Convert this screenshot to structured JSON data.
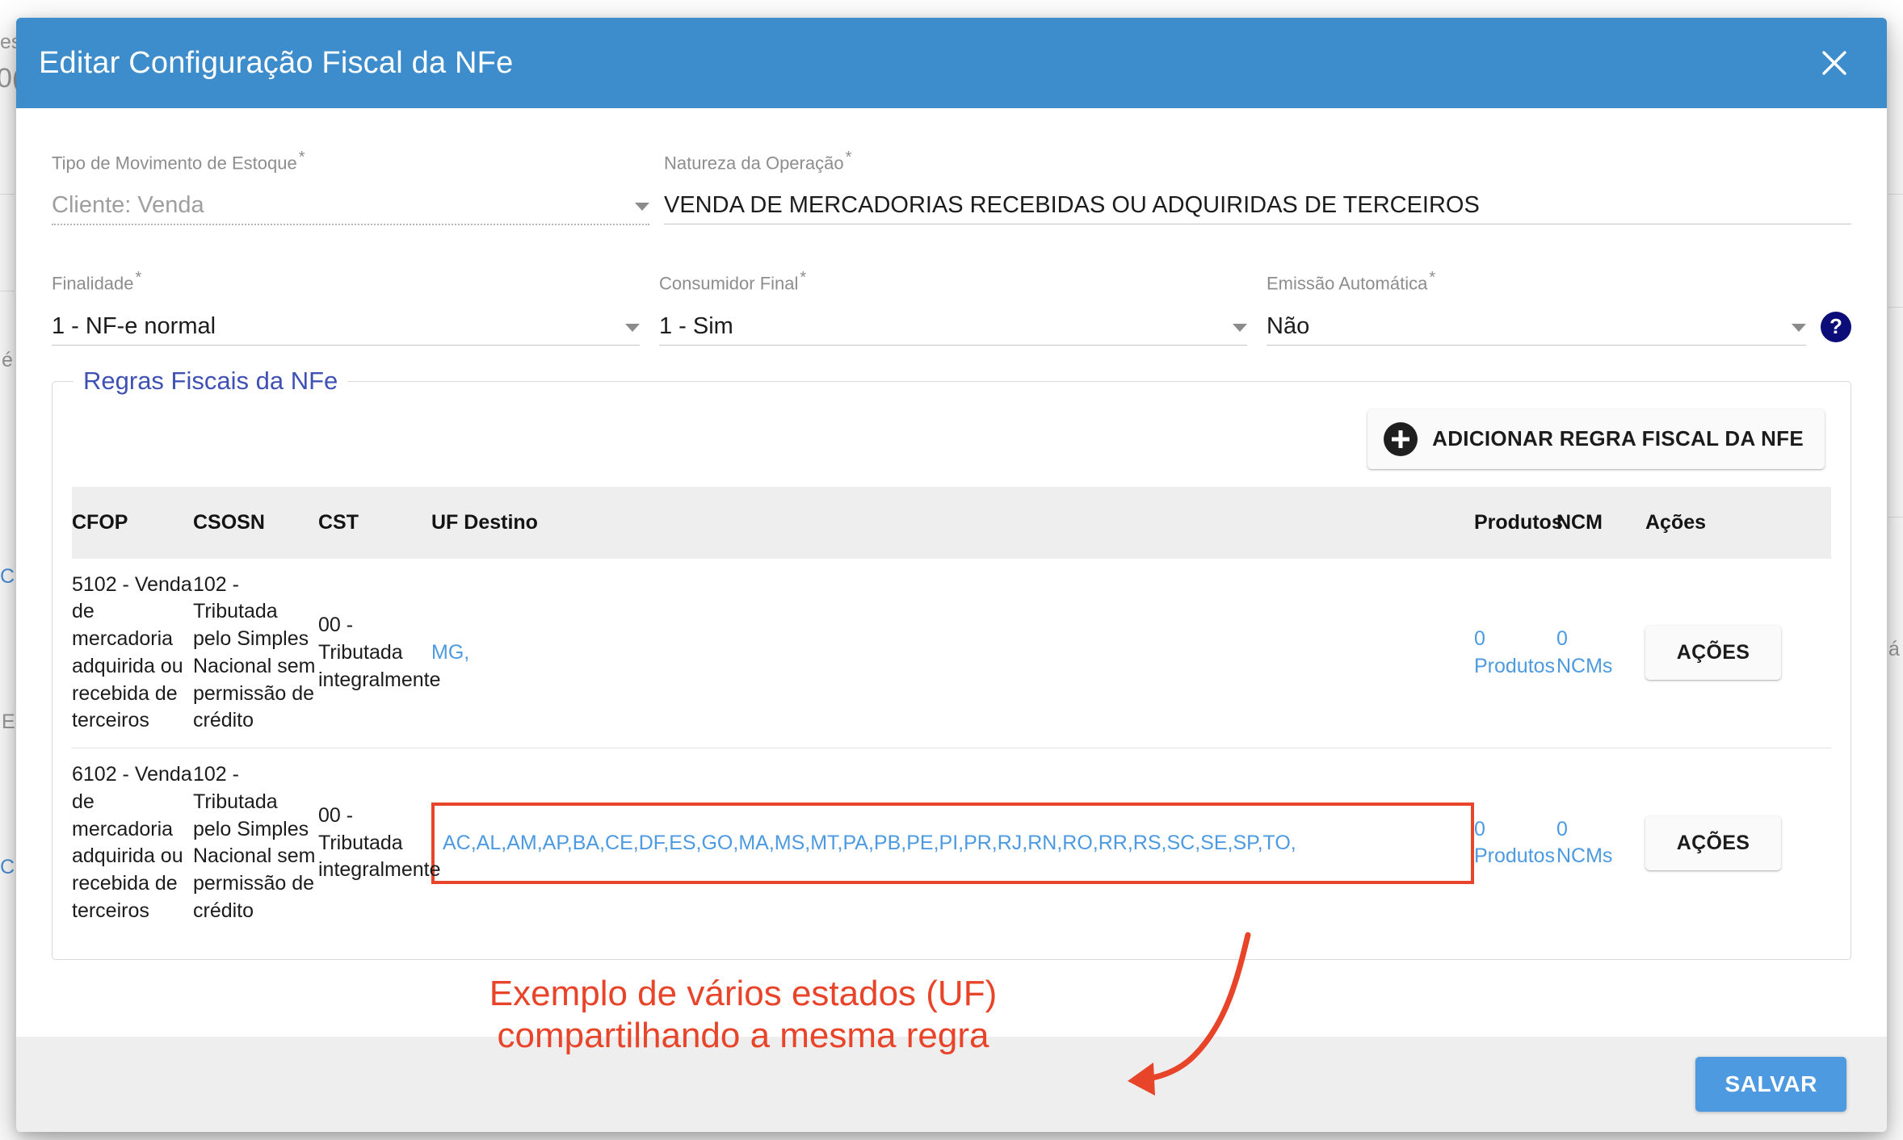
{
  "modal": {
    "title": "Editar Configuração Fiscal da NFe",
    "close_icon": "close-icon"
  },
  "form": {
    "tipo_movimento": {
      "label": "Tipo de Movimento de Estoque",
      "required_mark": "*",
      "value": "Cliente: Venda"
    },
    "natureza_operacao": {
      "label": "Natureza da Operação",
      "required_mark": "*",
      "value": "VENDA DE MERCADORIAS RECEBIDAS OU ADQUIRIDAS DE TERCEIROS"
    },
    "finalidade": {
      "label": "Finalidade",
      "required_mark": "*",
      "value": "1 - NF-e normal"
    },
    "consumidor_final": {
      "label": "Consumidor Final",
      "required_mark": "*",
      "value": "1 - Sim"
    },
    "emissao_automatica": {
      "label": "Emissão Automática",
      "required_mark": "*",
      "value": "Não"
    },
    "help_tooltip_icon": "question-mark-icon"
  },
  "rules_section": {
    "legend": "Regras Fiscais da NFe",
    "add_button_label": "ADICIONAR REGRA FISCAL DA NFE",
    "columns": {
      "cfop": "CFOP",
      "csosn": "CSOSN",
      "cst": "CST",
      "uf_destino": "UF Destino",
      "produtos": "Produtos",
      "ncm": "NCM",
      "acoes": "Ações"
    },
    "rows": [
      {
        "cfop": "5102 - Venda de mercadoria adquirida ou recebida de terceiros",
        "csosn": "102 - Tributada pelo Simples Nacional sem permissão de crédito",
        "cst": "00 - Tributada integralmente",
        "uf_destino": "MG,",
        "produtos_count": "0",
        "produtos_label": "Produtos",
        "ncm_count": "0",
        "ncm_label": "NCMs",
        "action_label": "AÇÕES",
        "highlighted": false
      },
      {
        "cfop": "6102 - Venda de mercadoria adquirida ou recebida de terceiros",
        "csosn": "102 - Tributada pelo Simples Nacional sem permissão de crédito",
        "cst": "00 - Tributada integralmente",
        "uf_destino": "AC,AL,AM,AP,BA,CE,DF,ES,GO,MA,MS,MT,PA,PB,PE,PI,PR,RJ,RN,RO,RR,RS,SC,SE,SP,TO,",
        "produtos_count": "0",
        "produtos_label": "Produtos",
        "ncm_count": "0",
        "ncm_label": "NCMs",
        "action_label": "AÇÕES",
        "highlighted": true
      }
    ]
  },
  "annotation": {
    "line1": "Exemplo de vários estados (UF)",
    "line2": "compartilhando a mesma regra",
    "color": "#e8442a"
  },
  "footer": {
    "save_label": "SALVAR"
  },
  "background": {
    "fragments": [
      "es",
      "0(",
      "é",
      "C",
      "E",
      "C",
      "á"
    ]
  },
  "colors": {
    "header_blue": "#3d8ccc",
    "link_blue": "#4d9ae0",
    "legend_indigo": "#3f51b5",
    "annotation_red": "#e8442a",
    "help_navy": "#0d0d7a",
    "footer_gray": "#eeeeee"
  }
}
